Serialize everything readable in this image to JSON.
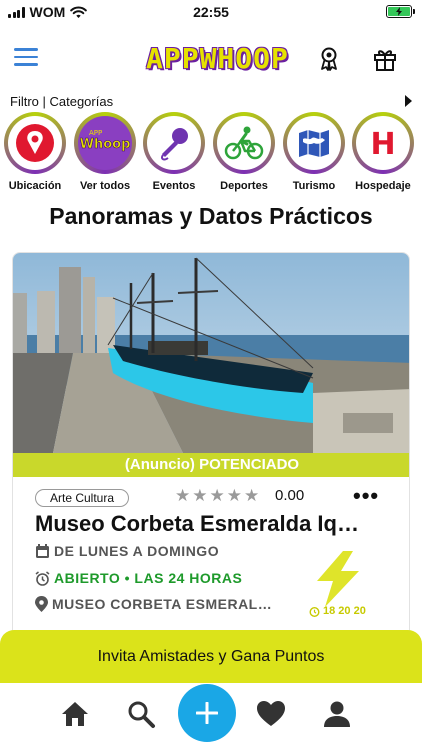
{
  "status": {
    "carrier": "WOM",
    "time": "22:55"
  },
  "header": {
    "logo": "APPWHOOP"
  },
  "filter": {
    "label": "Filtro | Categorías"
  },
  "categories": [
    {
      "label": "Ubicación",
      "icon": "location-pin-icon"
    },
    {
      "label": "Ver todos",
      "icon": "whoop-logo-icon"
    },
    {
      "label": "Eventos",
      "icon": "microphone-icon"
    },
    {
      "label": "Deportes",
      "icon": "cyclist-icon"
    },
    {
      "label": "Turismo",
      "icon": "map-icon"
    },
    {
      "label": "Hospedaje",
      "icon": "hotel-icon"
    }
  ],
  "section_title": "Panoramas y Datos Prácticos",
  "card": {
    "promo": "(Anuncio) POTENCIADO",
    "tag": "Arte Cultura",
    "rating": "0.00",
    "rating_stars": 0,
    "title": "Museo Corbeta Esmeralda Iq…",
    "schedule": "DE LUNES A DOMINGO",
    "status": "ABIERTO • LAS 24 HORAS",
    "location": "MUSEO CORBETA ESMERAL…",
    "counter": "18 20 20"
  },
  "invite": {
    "label": "Invita Amistades y Gana Puntos"
  },
  "colors": {
    "accent": "#dbe31a",
    "brand_purple": "#7d2fb4",
    "fab": "#1aa7e6",
    "open": "#1e9a2b"
  }
}
